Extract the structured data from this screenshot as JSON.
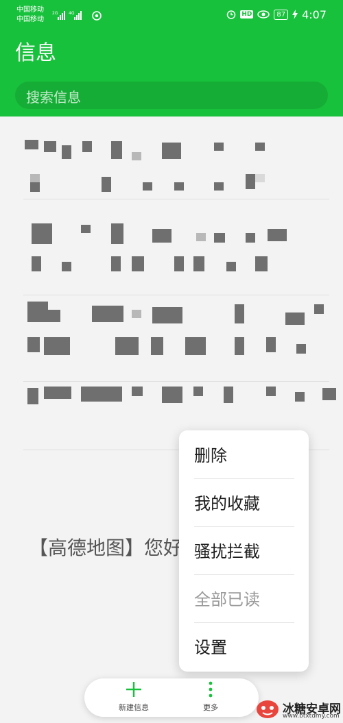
{
  "status_bar": {
    "carrier1": "中国移动",
    "carrier2": "中国移动",
    "net1": "2G",
    "net2": "4G",
    "hd": "HD",
    "battery": "87",
    "time": "4:07"
  },
  "header": {
    "title": "信息",
    "search_placeholder": "搜索信息"
  },
  "list": {
    "visible_preview": "【高德地图】您好，您在高..."
  },
  "menu": {
    "items": [
      {
        "label": "删除",
        "enabled": true
      },
      {
        "label": "我的收藏",
        "enabled": true
      },
      {
        "label": "骚扰拦截",
        "enabled": true
      },
      {
        "label": "全部已读",
        "enabled": false
      },
      {
        "label": "设置",
        "enabled": true
      }
    ]
  },
  "bottom_bar": {
    "new_message": "新建信息",
    "more": "更多"
  },
  "watermark": {
    "text": "冰糖安卓网",
    "sub": "www.btxtdmy.com"
  },
  "colors": {
    "accent": "#18c13c",
    "background": "#f3f3f3"
  },
  "icons": [
    "signal-icon",
    "wifi-icon",
    "alarm-icon",
    "eye-icon",
    "charging-icon",
    "plus-icon",
    "more-dots-icon"
  ]
}
